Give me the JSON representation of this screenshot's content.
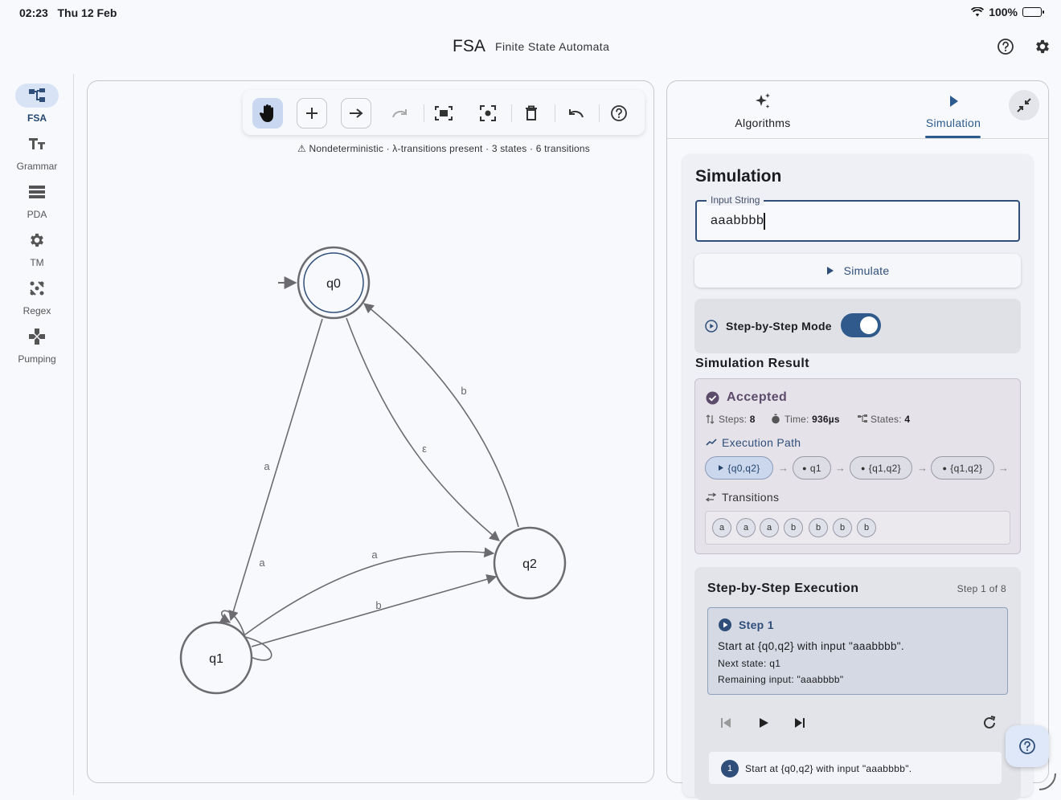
{
  "status_bar": {
    "time": "02:23",
    "date": "Thu 12 Feb",
    "battery": "100%"
  },
  "app_bar": {
    "title": "FSA",
    "subtitle": "Finite State Automata"
  },
  "nav_rail": {
    "items": [
      {
        "label": "FSA",
        "icon": "account-tree-icon",
        "active": true
      },
      {
        "label": "Grammar",
        "icon": "text-fields-icon",
        "active": false
      },
      {
        "label": "PDA",
        "icon": "stack-icon",
        "active": false
      },
      {
        "label": "TM",
        "icon": "gear-icon",
        "active": false
      },
      {
        "label": "Regex",
        "icon": "pattern-icon",
        "active": false
      },
      {
        "label": "Pumping",
        "icon": "gamepad-icon",
        "active": false
      }
    ]
  },
  "canvas": {
    "info": "⚠ Nondeterministic · λ-transitions present · 3 states · 6 transitions",
    "states": [
      {
        "name": "q0",
        "initial": true,
        "accepting": true
      },
      {
        "name": "q1",
        "initial": false,
        "accepting": false
      },
      {
        "name": "q2",
        "initial": false,
        "accepting": false
      }
    ],
    "transition_labels": {
      "q0_q1": "a",
      "q1_q1": "a",
      "q0_q2": "ε",
      "q2_q0": "b",
      "q1_q2_a": "a",
      "q1_q2_b": "b"
    },
    "toolbar_icons": [
      "pan-hand-icon",
      "add-state-icon",
      "add-transition-icon",
      "redo-icon",
      "fit-screen-icon",
      "center-focus-icon",
      "delete-icon",
      "undo-icon",
      "help-icon"
    ]
  },
  "panel": {
    "tabs": [
      {
        "label": "Algorithms",
        "icon": "sparkle-icon"
      },
      {
        "label": "Simulation",
        "icon": "play-icon"
      }
    ],
    "active_tab": "Simulation"
  },
  "simulation": {
    "heading": "Simulation",
    "input_label": "Input String",
    "input_value": "aaabbbb",
    "simulate_label": "Simulate",
    "step_mode_label": "Step-by-Step Mode",
    "step_mode_on": true,
    "result_title": "Simulation Result",
    "result": {
      "status": "Accepted",
      "steps_label": "Steps:",
      "steps": "8",
      "time_label": "Time:",
      "time": "936µs",
      "states_label": "States:",
      "states": "4"
    },
    "execution_path_label": "Execution Path",
    "execution_path": [
      "{q0,q2}",
      "q1",
      "{q1,q2}",
      "{q1,q2}"
    ],
    "transitions_label": "Transitions",
    "transitions": [
      "a",
      "a",
      "a",
      "b",
      "b",
      "b",
      "b"
    ],
    "step_section": {
      "title": "Step-by-Step Execution",
      "counter": "Step 1 of 8",
      "step_name": "Step 1",
      "description": "Start at {q0,q2} with input \"aaabbbb\".",
      "next_state": "Next state: q1",
      "remaining": "Remaining input: \"aaabbbb\"",
      "history": [
        {
          "num": "1",
          "text": "Start at {q0,q2} with input \"aaabbbb\"."
        }
      ]
    }
  },
  "colors": {
    "accent": "#2f4f7a",
    "accepted": "#5d4b6b",
    "nav_active": "#d8e3f6"
  }
}
